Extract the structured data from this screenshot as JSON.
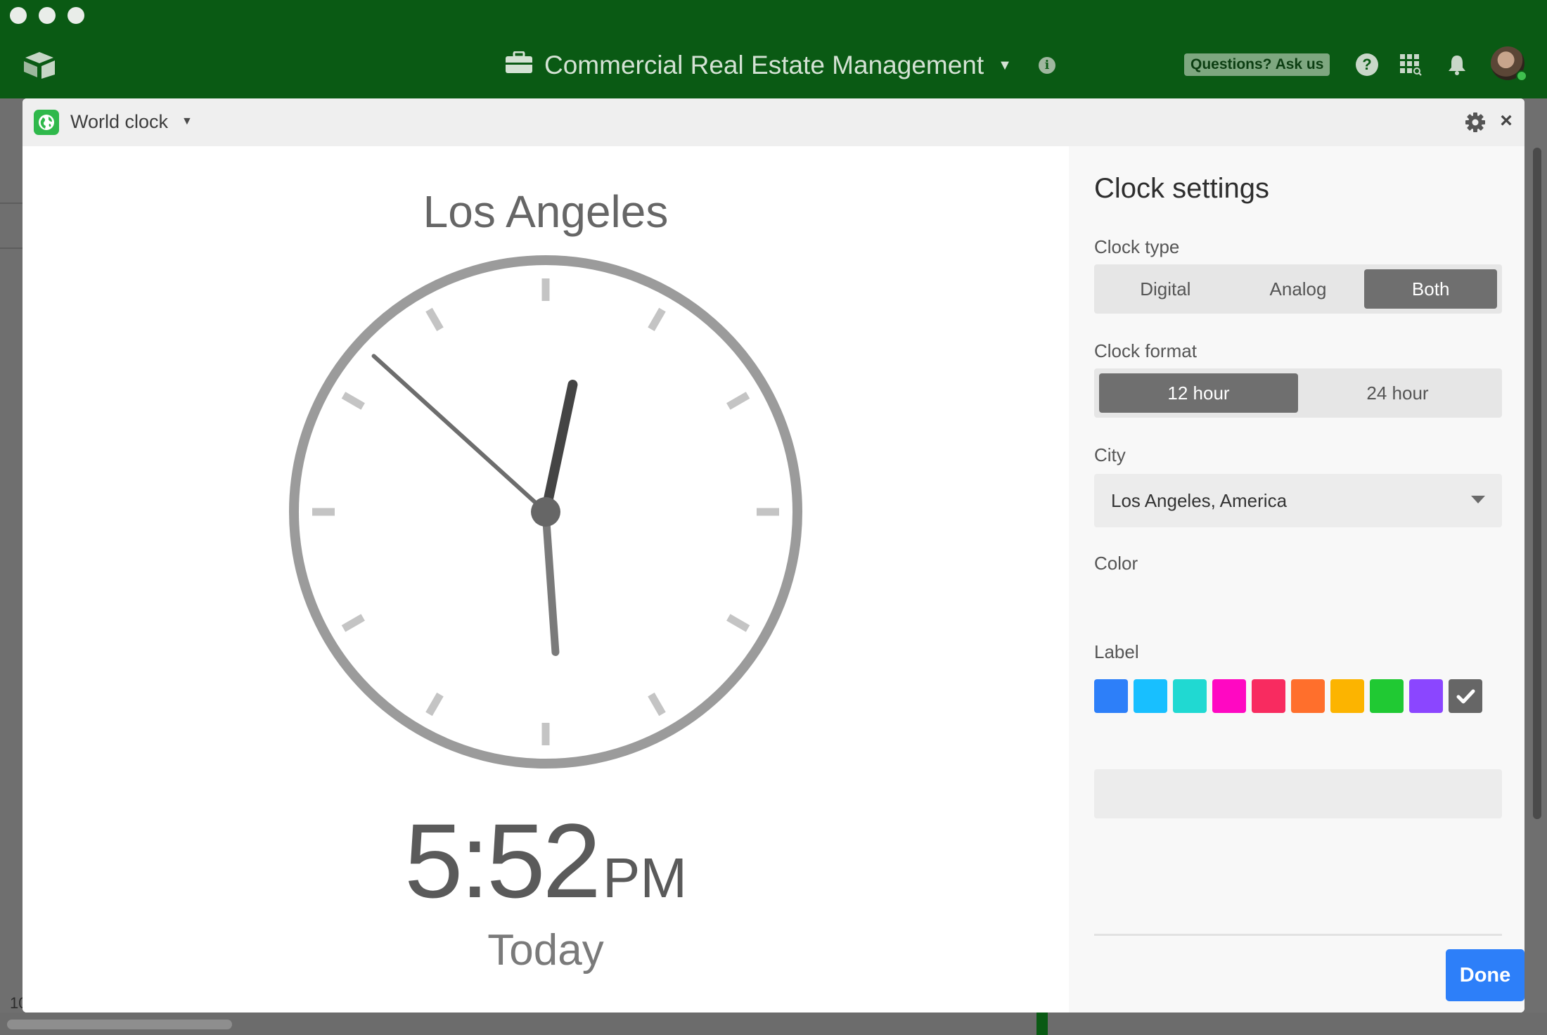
{
  "app": {
    "base_title": "Commercial Real Estate Management",
    "ask_label": "Questions? Ask us",
    "help_glyph": "?"
  },
  "block": {
    "name": "World clock",
    "close_glyph": "×"
  },
  "clock": {
    "city": "Los Angeles",
    "time": "5:52",
    "ampm": "PM",
    "day": "Today",
    "hour": 5,
    "minute": 52,
    "second": 2
  },
  "settings": {
    "title": "Clock settings",
    "clock_type_label": "Clock type",
    "clock_type_options": [
      "Digital",
      "Analog",
      "Both"
    ],
    "clock_type_selected": "Both",
    "clock_format_label": "Clock format",
    "clock_format_options": [
      "12 hour",
      "24 hour"
    ],
    "clock_format_selected": "12 hour",
    "city_label": "City",
    "city_value": "Los Angeles, America",
    "color_label": "Color",
    "colors": [
      "#2d7ff9",
      "#18bfff",
      "#20d9d2",
      "#ff08c2",
      "#f82b60",
      "#ff6f2c",
      "#fcb400",
      "#20c933",
      "#8b46ff",
      "#666666"
    ],
    "color_selected_index": 9,
    "label_label": "Label",
    "label_value": "",
    "done_label": "Done"
  },
  "background": {
    "row_number": "10"
  },
  "colors": {
    "appbar": "#0a5a14",
    "accent_blue": "#2d7ff9",
    "segment_active": "#6f6f6f"
  }
}
